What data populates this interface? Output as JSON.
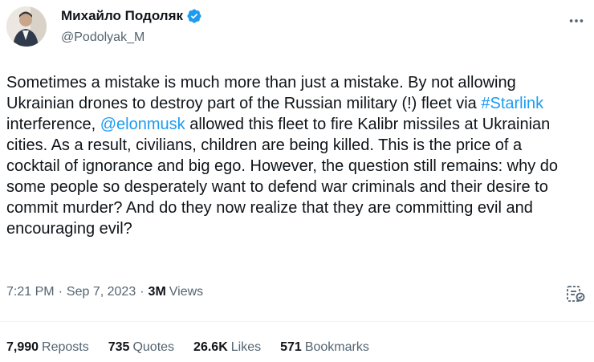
{
  "author": {
    "display_name": "Михайло Подоляк",
    "handle": "@Podolyak_M",
    "verified": true
  },
  "icons": {
    "verified": "verified-badge-icon",
    "more": "more-dots-icon",
    "analytics": "analytics-icon"
  },
  "colors": {
    "link": "#1d9bf0",
    "secondary_text": "#536471",
    "verified": "#1d9bf0"
  },
  "tweet": {
    "text_1": "Sometimes a mistake is much more than just a mistake. By not allowing Ukrainian drones to destroy part of the Russian military (!) fleet via ",
    "hashtag": "#Starlink",
    "text_2": " interference, ",
    "mention": "@elonmusk",
    "text_3": " allowed this fleet to fire Kalibr missiles at Ukrainian cities. As a result, civilians, children are being killed. This is the price of a cocktail of ignorance and big ego. However, the question still remains: why do some people so desperately want to defend war criminals and their desire to commit murder? And do they now realize that they are committing evil and encouraging evil?"
  },
  "meta": {
    "time": "7:21 PM",
    "separator": "·",
    "date": "Sep 7, 2023",
    "views_count": "3M",
    "views_label": "Views"
  },
  "stats": {
    "reposts_count": "7,990",
    "reposts_label": "Reposts",
    "quotes_count": "735",
    "quotes_label": "Quotes",
    "likes_count": "26.6K",
    "likes_label": "Likes",
    "bookmarks_count": "571",
    "bookmarks_label": "Bookmarks"
  }
}
